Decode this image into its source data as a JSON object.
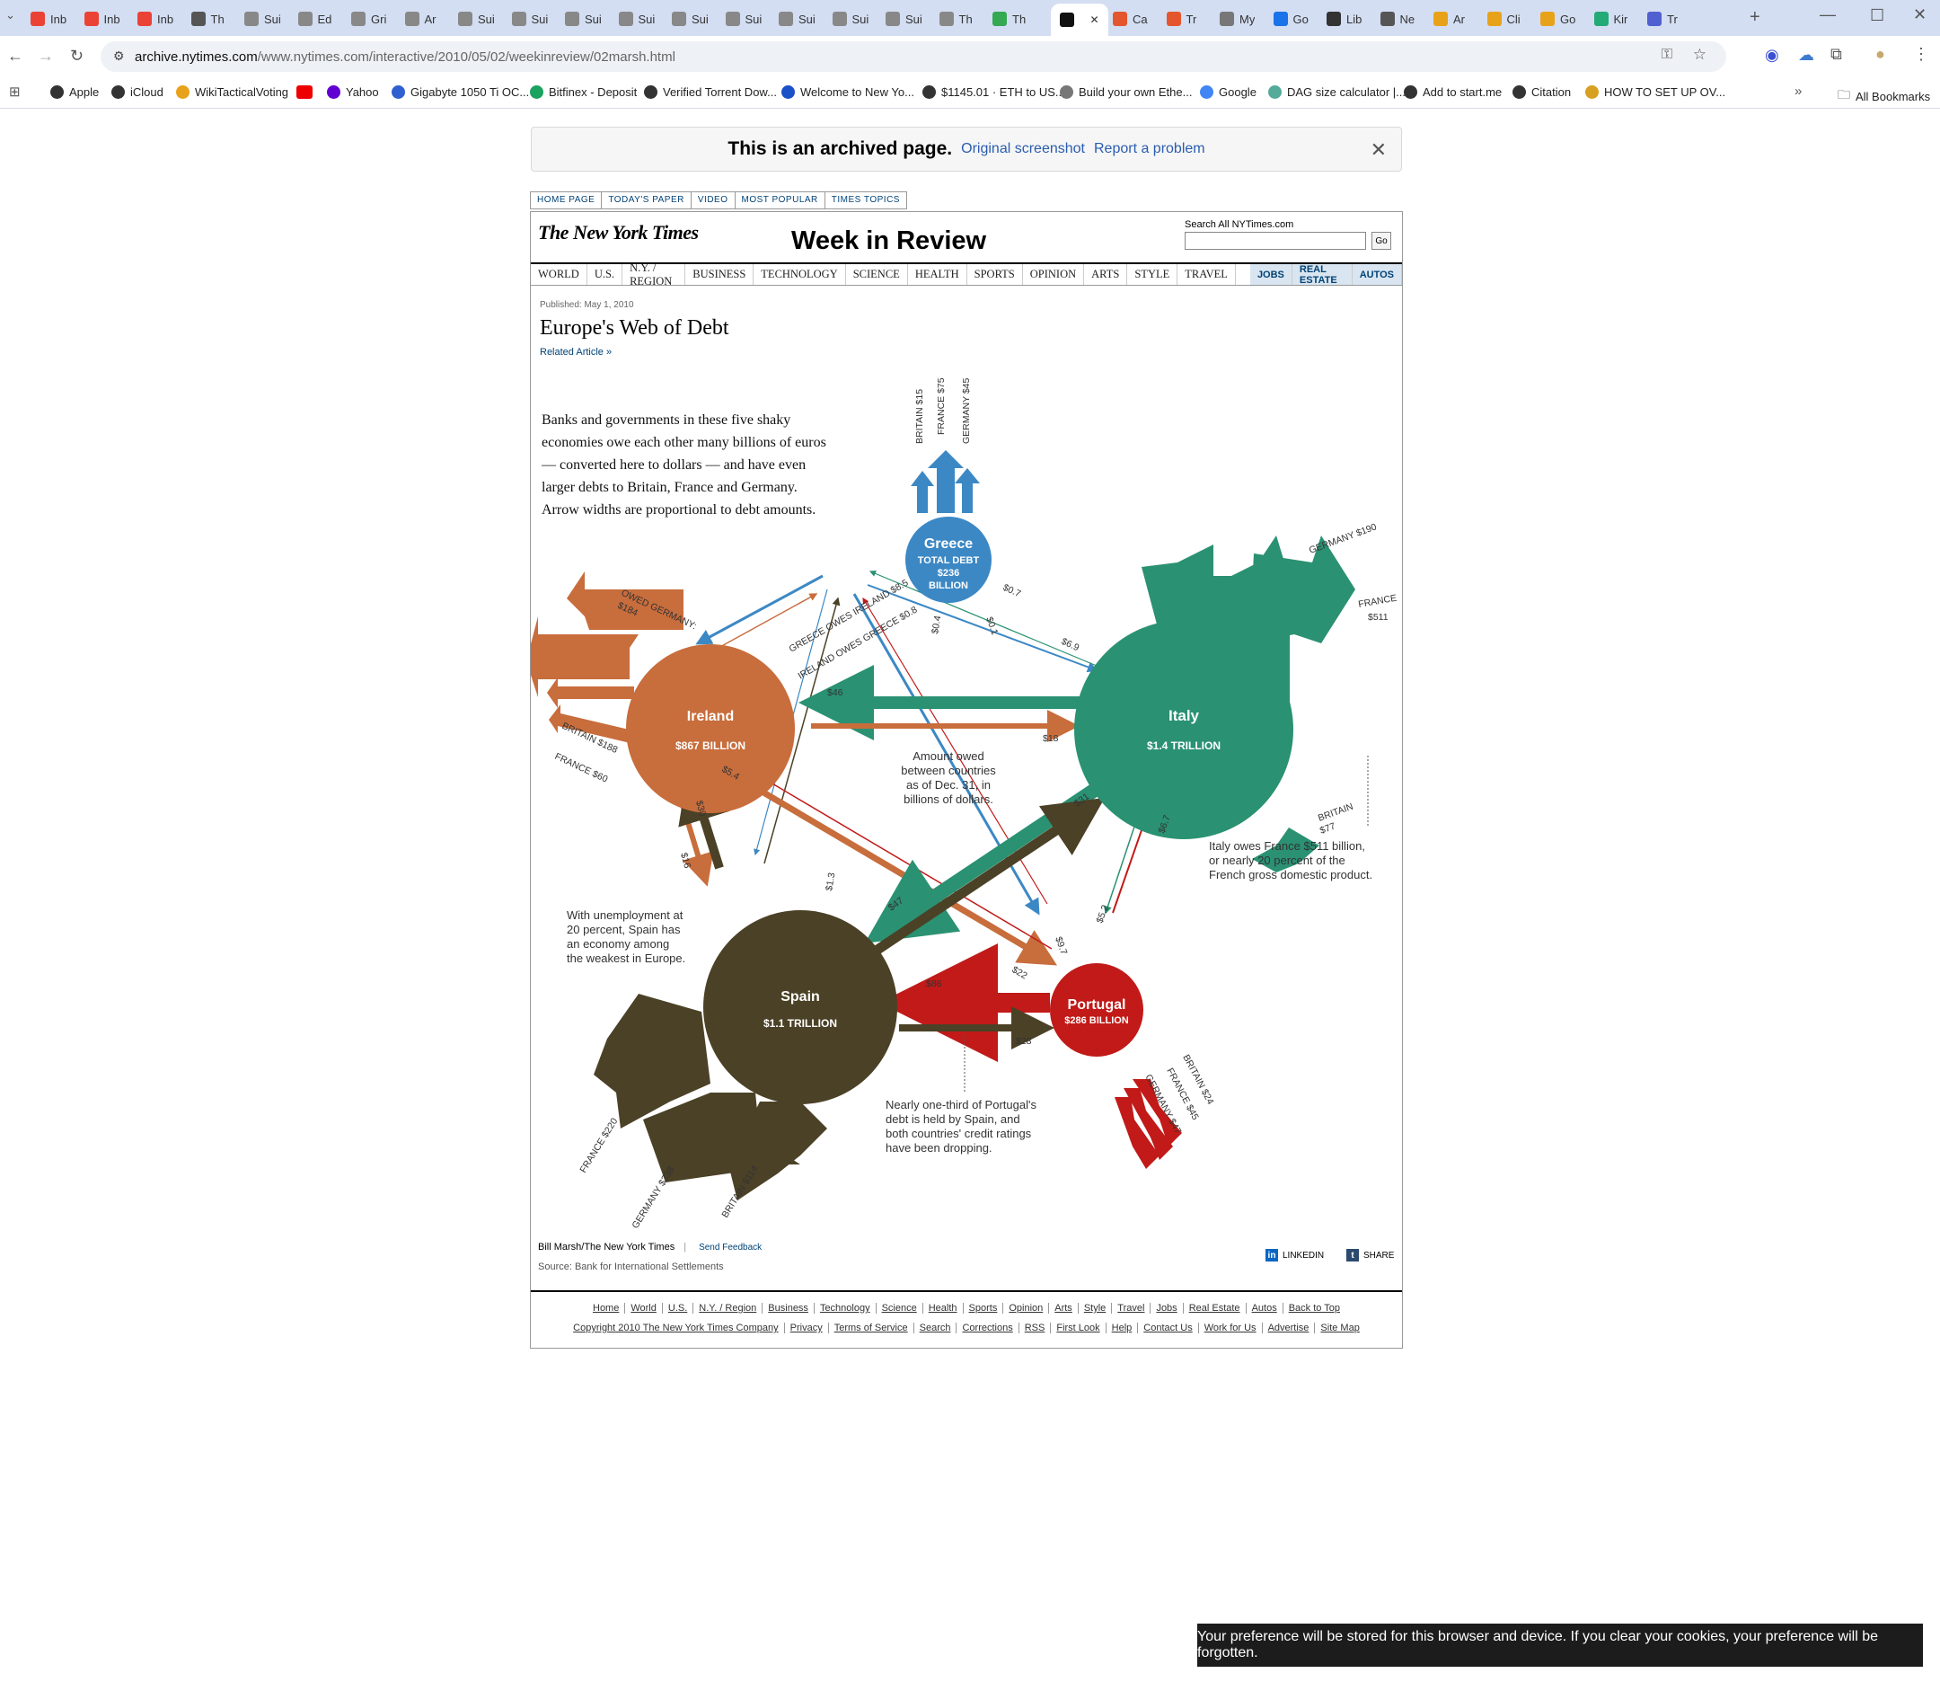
{
  "browser": {
    "tabs": [
      "Inb",
      "Inb",
      "Inb",
      "Th",
      "Sui",
      "Ed",
      "Gri",
      "Ar",
      "Sui",
      "Sui",
      "Sui",
      "Sui",
      "Sui",
      "Sui",
      "Sui",
      "Sui",
      "Sui",
      "Th",
      "Th",
      "",
      "Ca",
      "Tr",
      "My",
      "Go",
      "Lib",
      "Ne",
      "Ar",
      "Cli",
      "Go",
      "Kir",
      "Tr"
    ],
    "url_host": "archive.nytimes.com",
    "url_path": "/www.nytimes.com/interactive/2010/05/02/weekinreview/02marsh.html",
    "bookmarks": [
      "Apple",
      "iCloud",
      "WikiTacticalVoting",
      "",
      "Yahoo",
      "Gigabyte 1050 Ti OC...",
      "Bitfinex - Deposit",
      "Verified Torrent Dow...",
      "Welcome to New Yo...",
      "$1145.01 · ETH to US...",
      "Build your own Ethe...",
      "Google",
      "DAG size calculator |...",
      "Add to start.me",
      "Citation",
      "HOW TO SET UP OV..."
    ],
    "all_bookmarks": "All Bookmarks"
  },
  "archive": {
    "title": "This is an archived page.",
    "original": "Original screenshot",
    "report": "Report a problem"
  },
  "nyt": {
    "topnav": [
      "HOME PAGE",
      "TODAY'S PAPER",
      "VIDEO",
      "MOST POPULAR",
      "TIMES TOPICS"
    ],
    "logo": "The New York Times",
    "section": "Week in Review",
    "search_label": "Search All NYTimes.com",
    "search_go": "Go",
    "sections": [
      "WORLD",
      "U.S.",
      "N.Y. / REGION",
      "BUSINESS",
      "TECHNOLOGY",
      "SCIENCE",
      "HEALTH",
      "SPORTS",
      "OPINION",
      "ARTS",
      "STYLE",
      "TRAVEL"
    ],
    "classifieds": [
      "JOBS",
      "REAL ESTATE",
      "AUTOS"
    ],
    "published": "Published: May 1, 2010",
    "headline": "Europe's Web of Debt",
    "related": "Related Article »",
    "credit": "Bill Marsh/The New York Times",
    "feedback": "Send Feedback",
    "source": "Source: Bank for International Settlements",
    "linkedin": "LINKEDIN",
    "share": "SHARE",
    "footer_row1": [
      "Home",
      "World",
      "U.S.",
      "N.Y. / Region",
      "Business",
      "Technology",
      "Science",
      "Health",
      "Sports",
      "Opinion",
      "Arts",
      "Style",
      "Travel",
      "Jobs",
      "Real Estate",
      "Autos",
      "Back to Top"
    ],
    "footer_row2": [
      "Copyright 2010 The New York Times Company",
      "Privacy",
      "Terms of Service",
      "Search",
      "Corrections",
      "RSS",
      "First Look",
      "Help",
      "Contact Us",
      "Work for Us",
      "Advertise",
      "Site Map"
    ]
  },
  "graphic": {
    "intro": [
      "Banks and governments in these five shaky",
      "economies owe each other many billions of euros",
      "— converted here to dollars — and have even",
      "larger debts to Britain, France and Germany.",
      "Arrow widths are proportional to debt amounts."
    ],
    "center_note": [
      "Amount owed",
      "between countries",
      "as of Dec. 31, in",
      "billions of dollars."
    ],
    "italy_note": [
      "Italy owes France $511 billion,",
      "or nearly 20 percent of the",
      "French gross domestic product."
    ],
    "spain_note": [
      "With unemployment at",
      "20 percent, Spain has",
      "an economy among",
      "the weakest in Europe."
    ],
    "portugal_note": [
      "Nearly one-third of Portugal's",
      "debt is held by Spain, and",
      "both countries' credit ratings",
      "have been dropping."
    ],
    "countries": {
      "greece": {
        "name": "Greece",
        "l1": "TOTAL DEBT",
        "l2": "$236",
        "l3": "BILLION"
      },
      "ireland": {
        "name": "Ireland",
        "debt": "$867 BILLION"
      },
      "italy": {
        "name": "Italy",
        "debt": "$1.4 TRILLION"
      },
      "spain": {
        "name": "Spain",
        "debt": "$1.1 TRILLION"
      },
      "portugal": {
        "name": "Portugal",
        "debt": "$286 BILLION"
      }
    },
    "labels": {
      "gr_britain": "BRITAIN $15",
      "gr_france": "FRANCE $75",
      "gr_germany": "GERMANY $45",
      "it_germany": "GERMANY $190",
      "it_france1": "FRANCE",
      "it_france2": "$511",
      "it_britain1": "BRITAIN",
      "it_britain2": "$77",
      "ir_germany1": "OWED GERMANY:",
      "ir_germany2": "$184",
      "ir_britain": "BRITAIN $188",
      "ir_france": "FRANCE $60",
      "gr_ir": "GREECE OWES IRELAND $8.5",
      "ir_gr": "IRELAND OWES GREECE $0.8",
      "gr_it": "$0.7",
      "it_gr": "$6.9",
      "gr_sp": "$0.4",
      "sp_gr": "$1.3",
      "gr_pt": "$0.1",
      "pt_gr": "$9.7",
      "it_ir": "$46",
      "ir_it": "$18",
      "ir_pt": "$22",
      "pt_ir": "$5.4",
      "ir_sp": "$16",
      "sp_ir": "$30",
      "it_sp": "$47",
      "sp_it": "$31",
      "it_pt": "$5.2",
      "pt_it": "$6.7",
      "pt_sp": "$86",
      "sp_pt": "$28",
      "sp_france": "FRANCE $220",
      "sp_germany": "GERMANY $238",
      "sp_britain": "BRITAIN $114",
      "pt_britain": "BRITAIN $24",
      "pt_france": "FRANCE $45",
      "pt_germany": "GERMANY $47"
    },
    "colors": {
      "greece": "#3c88c4",
      "ireland": "#c86d3c",
      "italy": "#2a9172",
      "spain": "#4b4126",
      "portugal": "#c11a18"
    }
  },
  "toast": "Your preference will be stored for this browser and device. If you clear your cookies, your preference will be forgotten."
}
